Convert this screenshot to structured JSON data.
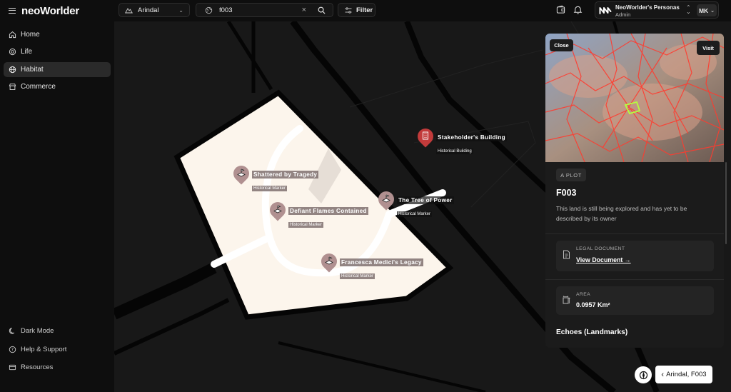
{
  "app": {
    "brand": "neoWorlder"
  },
  "sidebar": {
    "items": [
      {
        "label": "Home",
        "icon": "home-icon"
      },
      {
        "label": "Life",
        "icon": "life-icon"
      },
      {
        "label": "Habitat",
        "icon": "globe-icon",
        "active": true
      },
      {
        "label": "Commerce",
        "icon": "store-icon"
      }
    ],
    "bottom": [
      {
        "label": "Dark Mode",
        "icon": "moon-icon"
      },
      {
        "label": "Help & Support",
        "icon": "help-icon"
      },
      {
        "label": "Resources",
        "icon": "resources-icon"
      }
    ]
  },
  "topbar": {
    "location": "Arindal",
    "search_value": "f003",
    "filter_label": "Filter",
    "persona_name": "NeoWorlder's Personas",
    "persona_role": "Admin",
    "user_initials": "MK"
  },
  "map": {
    "markers": [
      {
        "title": "Shattered by Tragedy",
        "subtitle": "Historical Marker"
      },
      {
        "title": "Defiant Flames Contained",
        "subtitle": "Historical Marker"
      },
      {
        "title": "The Tree of Power",
        "subtitle": "Historical Marker"
      },
      {
        "title": "Francesca Medici's Legacy",
        "subtitle": "Historical Marker"
      },
      {
        "title": "Stakeholder's Building",
        "subtitle": "Historical Building"
      }
    ]
  },
  "panel": {
    "close_label": "Close",
    "visit_label": "Visit",
    "badge": "A PLOT",
    "title": "F003",
    "description": "This land is still being explored and has yet to be described by its owner",
    "legal": {
      "label": "LEGAL DOCUMENT",
      "link": "View Document →"
    },
    "area": {
      "label": "AREA",
      "value": "0.0957 Km²"
    },
    "echoes_title": "Echoes (Landmarks)"
  },
  "breadcrumb": {
    "label": "Arindal, F003"
  },
  "colors": {
    "plot_fill": "#fcf5ec",
    "pin": "#b09090",
    "building_pin": "#c23b3b"
  }
}
